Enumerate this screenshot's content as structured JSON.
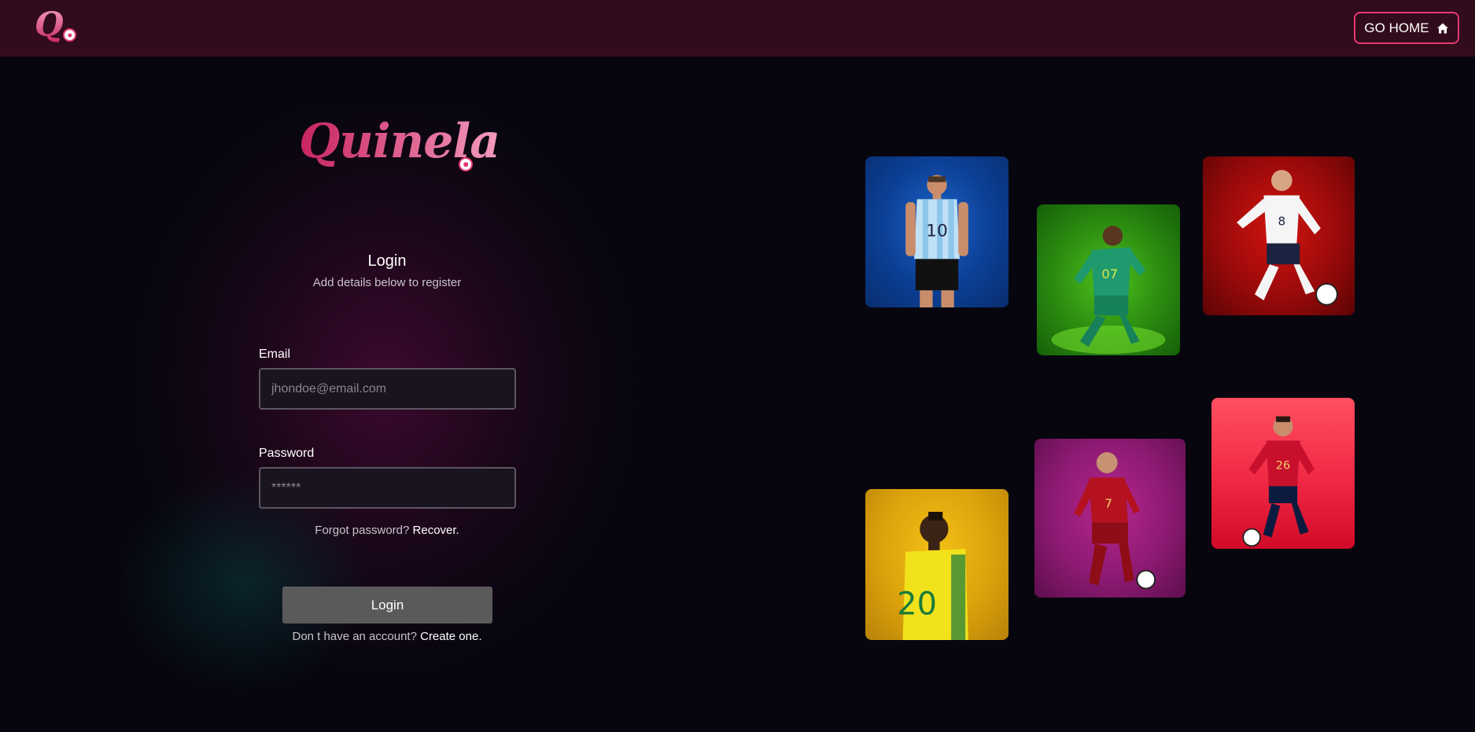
{
  "header": {
    "logo_letter": "Q",
    "go_home_label": "GO HOME"
  },
  "brand": {
    "wordmark": "Quinela"
  },
  "login": {
    "title": "Login",
    "subtitle": "Add details below to register",
    "email_label": "Email",
    "email_placeholder": "jhondoe@email.com",
    "password_label": "Password",
    "password_placeholder": "******",
    "forgot_text": "Forgot password?",
    "recover_link": "Recover.",
    "submit_label": "Login",
    "no_account_text": "Don t have an account?",
    "create_link": "Create one."
  },
  "gallery": {
    "players": [
      {
        "id": "argentina",
        "number": "10",
        "bg": "#0c3f95",
        "shirt": "#bfe0f5",
        "shorts": "#111111"
      },
      {
        "id": "senegal",
        "number": "07",
        "bg": "#2a8a10",
        "shirt": "#1f9a6e",
        "shorts": "#17815a"
      },
      {
        "id": "england",
        "number": "8",
        "bg": "#9a0a0a",
        "shirt": "#f5f5f5",
        "shorts": "#1b2340"
      },
      {
        "id": "brazil",
        "number": "20",
        "bg": "#dca20c",
        "shirt": "#f2e21c",
        "shorts": "#1a7a3a"
      },
      {
        "id": "portugal",
        "number": "7",
        "bg": "#8c1a72",
        "shirt": "#b3121e",
        "shorts": "#8e0d16"
      },
      {
        "id": "spain",
        "number": "26",
        "bg": "#f02843",
        "shirt": "#c8102e",
        "shorts": "#0b1b3f"
      }
    ]
  },
  "colors": {
    "accent": "#e6396f",
    "topbar": "#320c1c",
    "background": "#07060f",
    "button": "#5a5a5a"
  }
}
